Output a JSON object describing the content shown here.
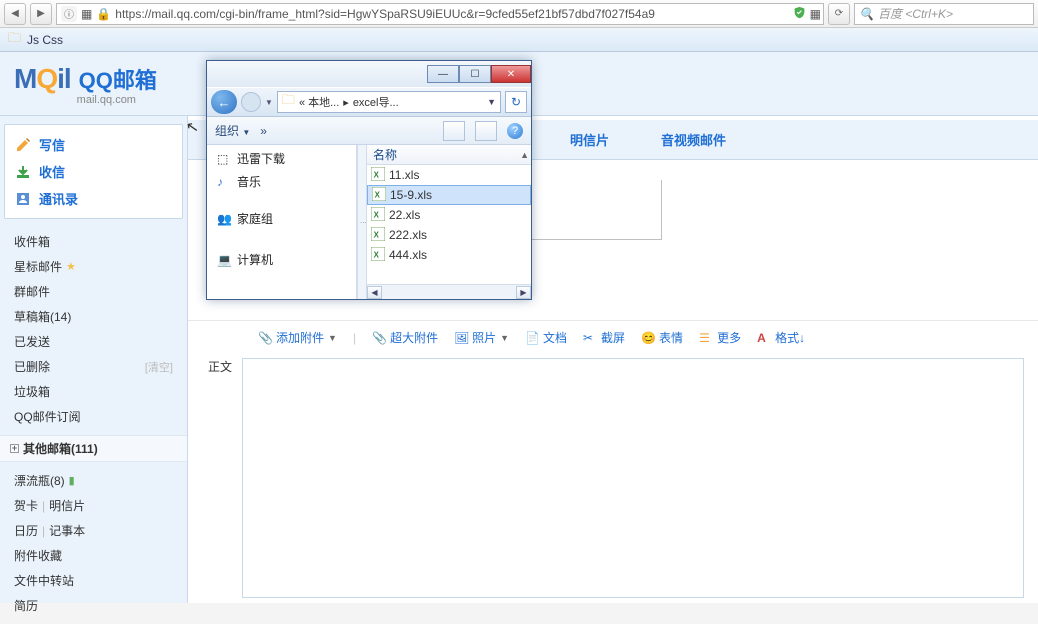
{
  "browser": {
    "url": "https://mail.qq.com/cgi-bin/frame_html?sid=HgwYSpaRSU9iEUUc&r=9cfed55ef21bf57dbd7f027f54a9",
    "search_placeholder": "百度 <Ctrl+K>",
    "bookmark": "Js Css"
  },
  "logo": {
    "brand": "MQil",
    "cn": "QQ邮箱",
    "sub": "mail.qq.com"
  },
  "sidebar": {
    "actions": {
      "compose": "写信",
      "receive": "收信",
      "contacts": "通讯录"
    },
    "folders": {
      "inbox": "收件箱",
      "star": "星标邮件",
      "group": "群邮件",
      "drafts": "草稿箱(14)",
      "sent": "已发送",
      "deleted": "已删除",
      "deleted_hint": "[清空]",
      "spam": "垃圾箱",
      "subscribe": "QQ邮件订阅"
    },
    "other_title": "其他邮箱(111)",
    "extras": {
      "drift_bottle": "漂流瓶(8)",
      "cards": "贺卡",
      "postcard": "明信片",
      "calendar": "日历",
      "notes": "记事本",
      "fav": "附件收藏",
      "transfer": "文件中转站",
      "resume": "简历"
    }
  },
  "tabs": {
    "postcard": "明信片",
    "av_mail": "音视频邮件"
  },
  "toolbar": {
    "attach": "添加附件",
    "big_attach": "超大附件",
    "photo": "照片",
    "doc": "文档",
    "screenshot": "截屏",
    "emoji": "表情",
    "more": "更多",
    "format": "格式↓"
  },
  "compose": {
    "body_label": "正文"
  },
  "dialog": {
    "path_pre": "« 本地...",
    "path_sep": "▸",
    "path_cur": "excel导...",
    "organize": "组织",
    "name_col": "名称",
    "tree": {
      "xunlei": "迅雷下载",
      "music": "音乐",
      "homegroup": "家庭组",
      "computer": "计算机"
    },
    "files": [
      "11.xls",
      "15-9.xls",
      "22.xls",
      "222.xls",
      "444.xls"
    ],
    "selected_index": 1
  }
}
